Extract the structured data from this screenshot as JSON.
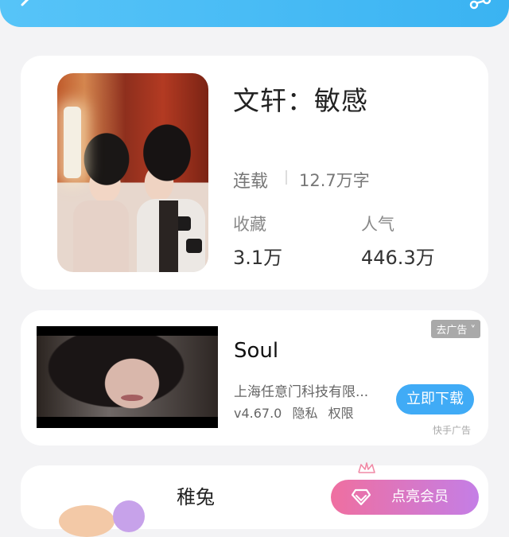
{
  "book": {
    "title": "文轩：敏感",
    "status": "连载",
    "word_count": "12.7万字",
    "favorites_label": "收藏",
    "favorites_value": "3.1万",
    "popularity_label": "人气",
    "popularity_value": "446.3万"
  },
  "ad": {
    "badge": "去广告 ˅",
    "app_name": "Soul",
    "company": "上海任意门科技有限...",
    "version": "v4.67.0",
    "privacy": "隐私",
    "permissions": "权限",
    "download_label": "立即下载",
    "source": "快手广告"
  },
  "user_card": {
    "name": "稚兔",
    "vip_label": "点亮会员"
  },
  "colors": {
    "accent": "#40abf6",
    "topbar": "#3ab3f2",
    "vip_gradient_start": "#ef6fa0",
    "vip_gradient_end": "#c47ee6"
  },
  "icons": {
    "back": "back-arrow-icon",
    "share": "share-icon",
    "crown": "crown-icon",
    "diamond": "diamond-icon"
  }
}
